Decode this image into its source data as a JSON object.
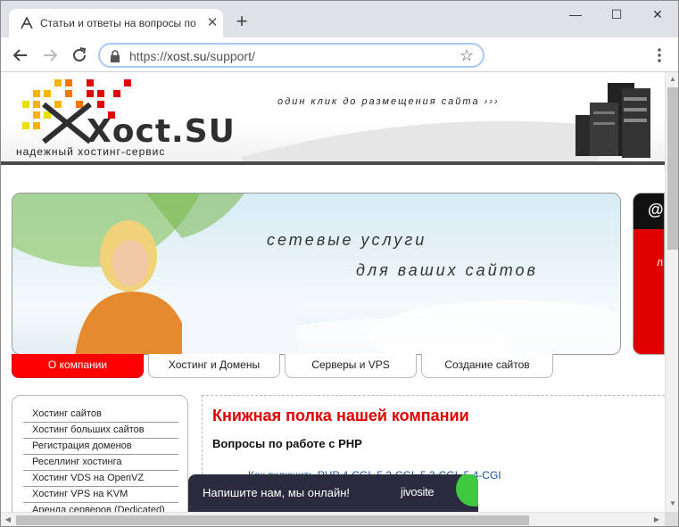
{
  "browser": {
    "tab_title": "Статьи и ответы на вопросы по",
    "tab_close": "✕",
    "new_tab": "+",
    "minimize": "—",
    "maximize": "☐",
    "close": "✕",
    "url_prefix": "https://",
    "url_host": "xost.su",
    "url_path": "/support/"
  },
  "header": {
    "logo": "Xoct.SU",
    "logo_sub": "надежный хостинг-сервис",
    "tagline": "один клик до размещения сайта ›››",
    "pixel_colors": [
      "#f5b400",
      "#e8e000",
      "#f07800",
      "#e00000"
    ]
  },
  "banner": {
    "line1": "сетевые услуги",
    "line2": "для ваших сайтов"
  },
  "side_ad": {
    "symbol": "@",
    "letter": "л"
  },
  "nav": {
    "tabs": [
      {
        "label": "О компании",
        "active": true
      },
      {
        "label": "Хостинг и Домены",
        "active": false
      },
      {
        "label": "Серверы и VPS",
        "active": false
      },
      {
        "label": "Создание сайтов",
        "active": false
      }
    ]
  },
  "sidebar": {
    "items": [
      "Хостинг сайтов",
      "Хостинг больших сайтов",
      "Регистрация доменов",
      "Реселлинг хостинга",
      "Хостинг VDS на OpenVZ",
      "Хостинг VPS на KVM",
      "Аренда серверов (Dedicated)"
    ]
  },
  "content": {
    "title": "Книжная полка нашей компании",
    "subtitle": "Вопросы по работе с PHP",
    "link": "Как включить PHP 4-CGI, 5.2-CGI, 5.3-CGI, 5.4-CGI"
  },
  "chat": {
    "text": "Напишите нам, мы онлайн!",
    "brand": "jivosite"
  },
  "colors": {
    "accent_red": "#e00000",
    "nav_active": "#ff0000",
    "link": "#1a4f9e"
  }
}
